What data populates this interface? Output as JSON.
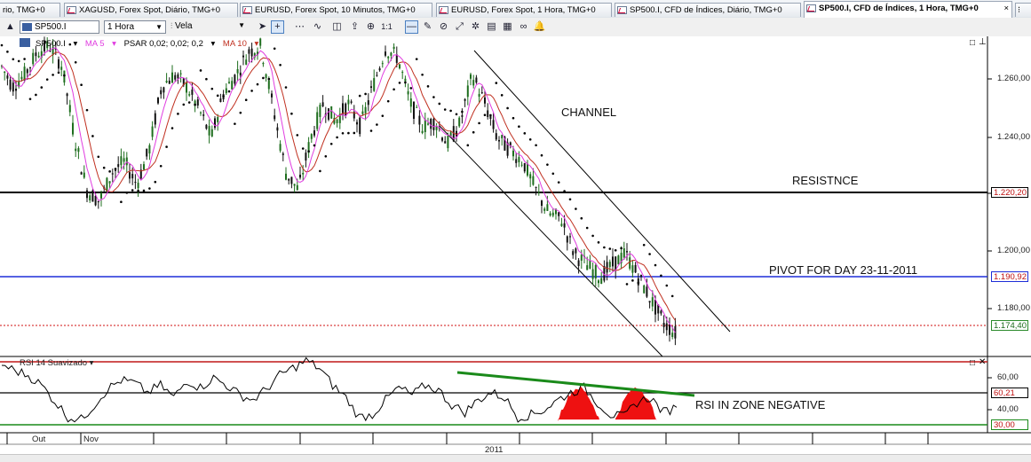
{
  "tabs": [
    {
      "label": "rio, TMG+0"
    },
    {
      "label": "XAGUSD, Forex Spot, Diário, TMG+0"
    },
    {
      "label": "EURUSD, Forex Spot, 10 Minutos, TMG+0"
    },
    {
      "label": "EURUSD, Forex Spot, 1 Hora, TMG+0"
    },
    {
      "label": "SP500.I, CFD de Índices, Diário, TMG+0"
    },
    {
      "label": "SP500.I, CFD de Índices, 1 Hora, TMG+0",
      "active": true
    }
  ],
  "toolbar": {
    "symbol": "SP500.I",
    "timeframe": "1 Hora",
    "chart_type": "Vela"
  },
  "legend": {
    "symbol": "SP500.I",
    "ma5": "MA 5",
    "psar": "PSAR 0,02; 0,02; 0,2",
    "ma10": "MA 10"
  },
  "rsi_title": "RSI 14 Suavizado",
  "annotations": {
    "channel": "CHANNEL",
    "resistance": "RESISTNCE",
    "pivot": "PIVOT FOR DAY 23-11-2011",
    "rsi_zone": "RSI IN ZONE NEGATIVE"
  },
  "price_axis": {
    "ticks": [
      "1.260,00",
      "1.240,00",
      "1.220,00",
      "1.200,00",
      "1.180,00"
    ],
    "tags": {
      "resistance": "1.220,20",
      "pivot": "1.190,92",
      "current": "1.174,40"
    }
  },
  "rsi_axis": {
    "ticks": [
      "60,00",
      "40,00"
    ],
    "tags": {
      "upper": "60,21",
      "lower": "30,00"
    }
  },
  "x_axis": {
    "labels": [
      "Out",
      "Nov"
    ],
    "year": "2011"
  },
  "colors": {
    "resistance": "#000000",
    "pivot": "#1e2ed8",
    "current": "#d01010",
    "ma5": "#e03ce0",
    "ma10": "#c03020",
    "rsi_trend": "#1a8a1a",
    "rsi_fill": "#ee1111"
  },
  "chart_data": {
    "type": "line",
    "ylim": [
      1165,
      1275
    ],
    "horizontal_levels": {
      "resistance": 1220.2,
      "pivot": 1190.92,
      "current": 1174.4
    },
    "x": [
      0,
      1,
      2,
      3,
      4,
      5,
      6,
      7,
      8,
      9,
      10,
      11,
      12,
      13,
      14,
      15,
      16,
      17,
      18,
      19,
      20,
      21,
      22,
      23,
      24,
      25,
      26,
      27,
      28,
      29,
      30,
      31,
      32,
      33,
      34,
      35,
      36,
      37,
      38,
      39,
      40
    ],
    "series": [
      {
        "values": [
          1266,
          1258,
          1262,
          1270,
          1272,
          1265,
          1240,
          1222,
          1218,
          1228,
          1232,
          1224,
          1236,
          1258,
          1262,
          1258,
          1250,
          1240,
          1256,
          1262,
          1270,
          1272,
          1250,
          1228,
          1222,
          1240,
          1252,
          1246,
          1252,
          1244,
          1258,
          1271,
          1268,
          1252,
          1244,
          1246,
          1238,
          1245,
          1262,
          1252,
          1240
        ]
      },
      {
        "values": [
          1242,
          1236,
          1232,
          1222,
          1214,
          1212,
          1200,
          1196,
          1192,
          1196,
          1200,
          1192,
          1184,
          1176,
          1172
        ]
      }
    ],
    "rsi": {
      "ylim": [
        20,
        80
      ],
      "levels": {
        "upper": 60.21,
        "lower": 30
      },
      "values": [
        75,
        70,
        66,
        58,
        45,
        32,
        30,
        42,
        55,
        62,
        60,
        52,
        58,
        48,
        62,
        56,
        64,
        58,
        50,
        46,
        55,
        66,
        72,
        78,
        72,
        58,
        48,
        32,
        34,
        46,
        56,
        50,
        58,
        54,
        42,
        36,
        46,
        52,
        48,
        32,
        34,
        38,
        46,
        52,
        56,
        44,
        34,
        32,
        44,
        48,
        36,
        40
      ]
    }
  }
}
